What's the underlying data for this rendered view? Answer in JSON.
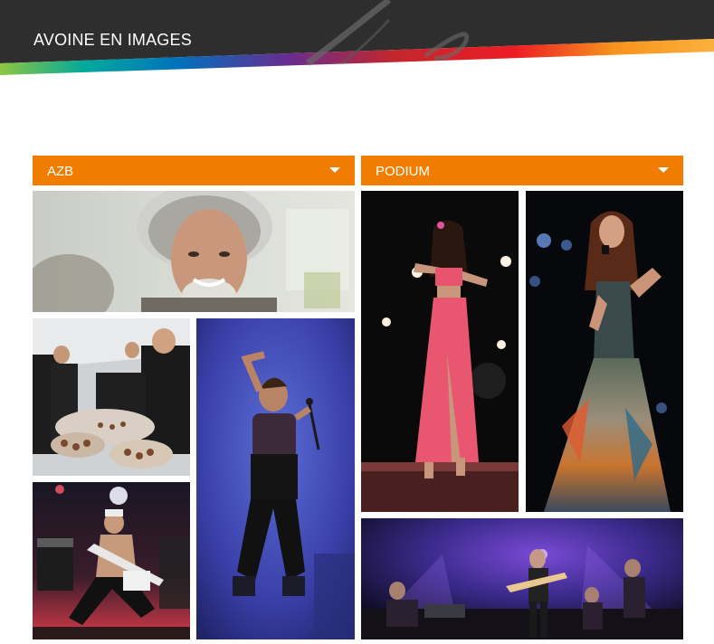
{
  "header": {
    "title": "AVOINE EN IMAGES"
  },
  "sections": {
    "azb": {
      "label": "AZB"
    },
    "podium": {
      "label": "PODIUM"
    }
  },
  "icons": {
    "dropdown": "chevron-down-icon"
  },
  "colors": {
    "accent": "#f07d00",
    "header_bg": "#2e2e2e"
  }
}
